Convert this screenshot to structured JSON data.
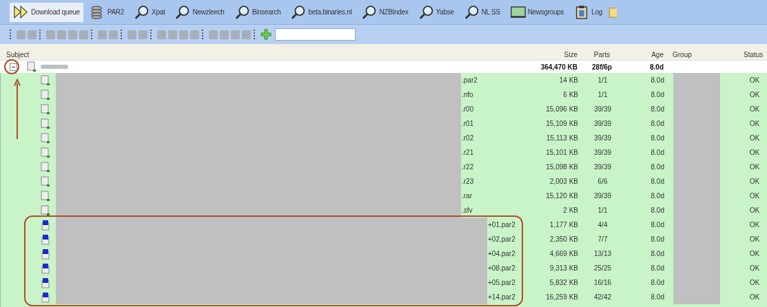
{
  "tabs": [
    {
      "label": "Download queue",
      "selected": true
    },
    {
      "label": "PAR2",
      "selected": false
    },
    {
      "label": "Xpat",
      "selected": false
    },
    {
      "label": "Newzleech",
      "selected": false
    },
    {
      "label": "Binsearch",
      "selected": false
    },
    {
      "label": "beta.binaries.nl",
      "selected": false
    },
    {
      "label": "NZBIndex",
      "selected": false
    },
    {
      "label": "Yabse",
      "selected": false
    },
    {
      "label": "NL SS",
      "selected": false
    },
    {
      "label": "Newsgroups",
      "selected": false
    },
    {
      "label": "Log",
      "selected": false
    }
  ],
  "table": {
    "columns": [
      "Subject",
      "Size",
      "Parts",
      "Age",
      "Group",
      "Status"
    ],
    "group_row": {
      "expanded": true,
      "size": "364,470 KB",
      "parts": "28f/6p",
      "age": "8.0d"
    },
    "rows": [
      {
        "kind": "file",
        "subject": ".par2",
        "size": "14 KB",
        "parts": "1/1",
        "age": "8.0d",
        "status": "OK"
      },
      {
        "kind": "file",
        "subject": ".nfo",
        "size": "6 KB",
        "parts": "1/1",
        "age": "8.0d",
        "status": "OK"
      },
      {
        "kind": "file",
        "subject": ".r00",
        "size": "15,096 KB",
        "parts": "39/39",
        "age": "8.0d",
        "status": "OK"
      },
      {
        "kind": "file",
        "subject": ".r01",
        "size": "15,109 KB",
        "parts": "39/39",
        "age": "8.0d",
        "status": "OK"
      },
      {
        "kind": "file",
        "subject": ".r02",
        "size": "15,113 KB",
        "parts": "39/39",
        "age": "8.0d",
        "status": "OK"
      },
      {
        "kind": "file",
        "subject": ".r21",
        "size": "15,101 KB",
        "parts": "39/39",
        "age": "8.0d",
        "status": "OK"
      },
      {
        "kind": "file",
        "subject": ".r22",
        "size": "15,098 KB",
        "parts": "39/39",
        "age": "8.0d",
        "status": "OK"
      },
      {
        "kind": "file",
        "subject": ".r23",
        "size": "2,003 KB",
        "parts": "6/6",
        "age": "8.0d",
        "status": "OK"
      },
      {
        "kind": "file",
        "subject": ".rar",
        "size": "15,120 KB",
        "parts": "39/39",
        "age": "8.0d",
        "status": "OK"
      },
      {
        "kind": "file",
        "subject": ".sfv",
        "size": "2 KB",
        "parts": "1/1",
        "age": "8.0d",
        "status": "OK"
      },
      {
        "kind": "par",
        "subject": "+01.par2",
        "size": "1,177 KB",
        "parts": "4/4",
        "age": "8.0d",
        "status": "OK"
      },
      {
        "kind": "par",
        "subject": "+02.par2",
        "size": "2,350 KB",
        "parts": "7/7",
        "age": "8.0d",
        "status": "OK"
      },
      {
        "kind": "par",
        "subject": "+04.par2",
        "size": "4,669 KB",
        "parts": "13/13",
        "age": "8.0d",
        "status": "OK"
      },
      {
        "kind": "par",
        "subject": "+08.par2",
        "size": "9,313 KB",
        "parts": "25/25",
        "age": "8.0d",
        "status": "OK"
      },
      {
        "kind": "par",
        "subject": "+05.par2",
        "size": "5,832 KB",
        "parts": "16/16",
        "age": "8.0d",
        "status": "OK"
      },
      {
        "kind": "par",
        "subject": "+14.par2",
        "size": "16,259 KB",
        "parts": "42/42",
        "age": "8.0d",
        "status": "OK"
      }
    ]
  }
}
